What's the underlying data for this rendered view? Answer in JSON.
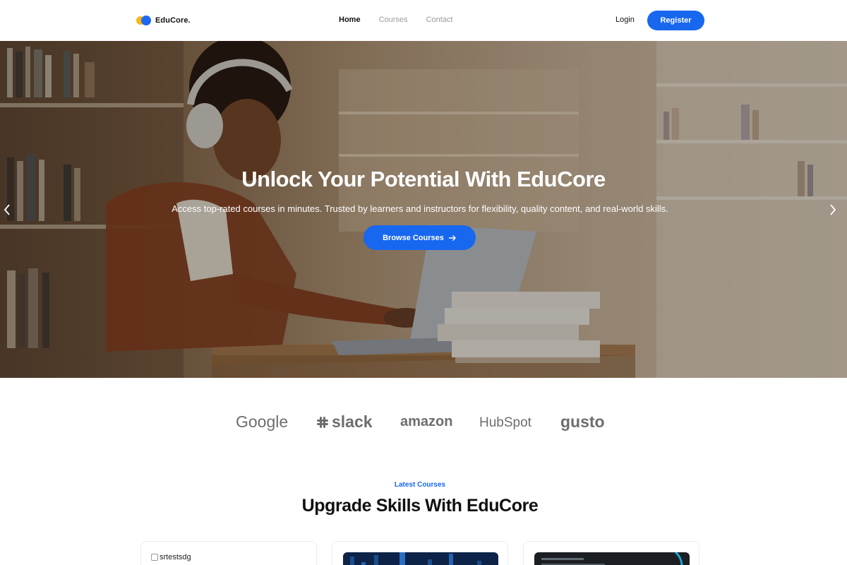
{
  "nav": {
    "brand": "EduCore.",
    "links": [
      {
        "label": "Home",
        "active": true
      },
      {
        "label": "Courses",
        "active": false
      },
      {
        "label": "Contact",
        "active": false
      }
    ],
    "login": "Login",
    "register": "Register"
  },
  "hero": {
    "title": "Unlock Your Potential With EduCore",
    "subtitle": "Access top-rated courses in minutes. Trusted by learners and instructors for flexibility, quality content, and real-world skills.",
    "cta": "Browse Courses",
    "cta_icon": "arrow-right-icon",
    "prev_icon": "chevron-left-icon",
    "next_icon": "chevron-right-icon"
  },
  "partners": [
    "Google",
    "slack",
    "amazon",
    "HubSpot",
    "gusto"
  ],
  "courses": {
    "eyebrow": "Latest Courses",
    "title": "Upgrade Skills With EduCore",
    "cards": [
      {
        "alt_text": "srtestsdg"
      },
      {
        "alt_text": ""
      },
      {
        "alt_text": ""
      }
    ]
  },
  "colors": {
    "accent": "#1867ef",
    "brand_yellow": "#f5b81c",
    "brand_blue": "#1d6af0"
  }
}
